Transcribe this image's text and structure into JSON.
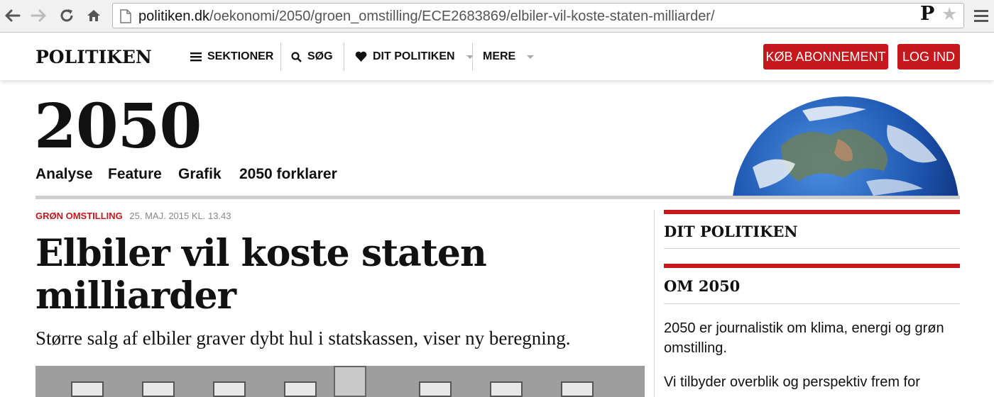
{
  "browser": {
    "url_domain": "politiken.dk",
    "url_path": "/oekonomi/2050/groen_omstilling/ECE2683869/elbiler-vil-koste-staten-milliarder/",
    "extension_letter": "P"
  },
  "header": {
    "logo": "POLITIKEN",
    "nav": {
      "sections": "SEKTIONER",
      "search": "SØG",
      "my_politiken": "DIT POLITIKEN",
      "more": "MERE"
    },
    "subscribe": "KØB ABONNEMENT",
    "login": "LOG IND"
  },
  "section": {
    "title": "2050",
    "subnav": [
      "Analyse",
      "Feature",
      "Grafik",
      "2050 forklarer"
    ]
  },
  "article": {
    "category": "GRØN OMSTILLING",
    "date": "25. MAJ. 2015 KL. 13.43",
    "headline_line1": "Elbiler vil koste staten",
    "headline_line2": "milliarder",
    "lede": "Større salg af elbiler graver dybt hul i statskassen, viser ny beregning."
  },
  "sidebar": {
    "dit_politiken": "DIT POLITIKEN",
    "om_title": "OM 2050",
    "p1": "2050 er journalistik om klima, energi og grøn omstilling.",
    "p2": "Vi tilbyder overblik og perspektiv frem for"
  },
  "colors": {
    "brand_red": "#c4181c",
    "rule_gray": "#cfcfcf"
  }
}
